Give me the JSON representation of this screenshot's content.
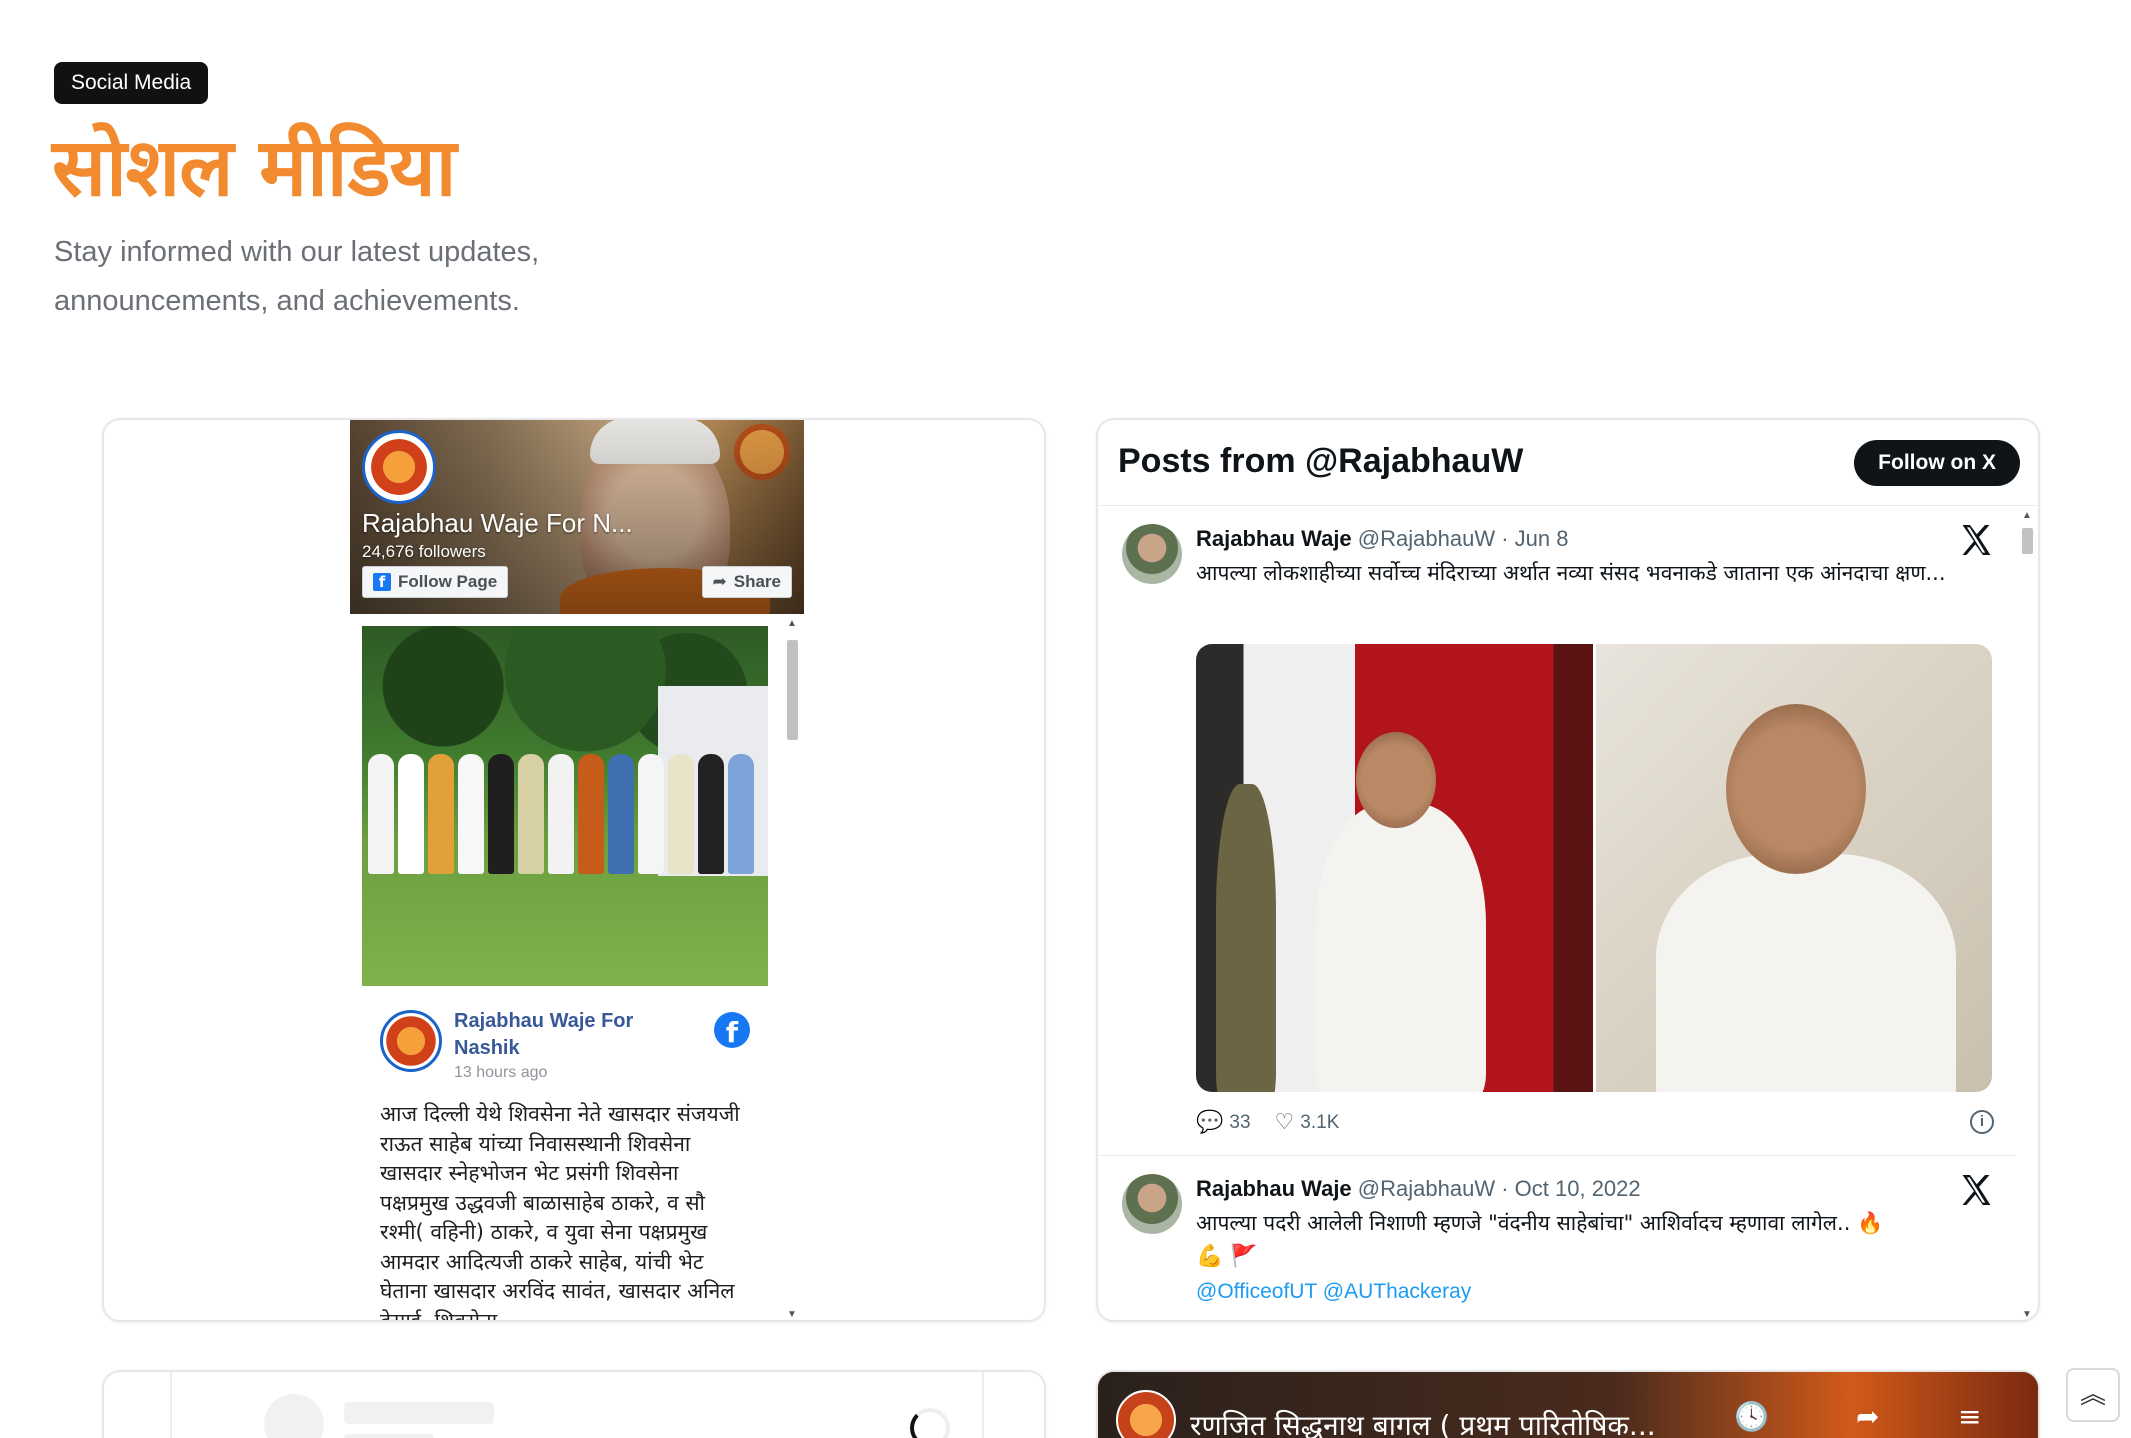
{
  "section": {
    "tag": "Social Media",
    "title": "सोशल मीडिया",
    "subtitle": "Stay informed with our latest updates, announcements, and achievements."
  },
  "facebook": {
    "page_name": "Rajabhau Waje For N...",
    "followers": "24,676 followers",
    "follow_label": "Follow Page",
    "share_label": "Share",
    "post": {
      "author": "Rajabhau Waje For Nashik",
      "time": "13 hours ago",
      "text": "आज दिल्ली येथे शिवसेना नेते खासदार संजयजी राऊत साहेब यांच्या निवासस्थानी शिवसेना खासदार स्नेहभोजन भेट प्रसंगी शिवसेना पक्षप्रमुख उद्धवजी बाळासाहेब ठाकरे, व सौ रश्मी( वहिनी) ठाकरे, व युवा सेना पक्षप्रमुख आमदार आदित्यजी ठाकरे साहेब, यांची भेट घेताना खासदार अरविंद सावंत, खासदार अनिल देसाई, शिवसेना"
    }
  },
  "x": {
    "header_title": "Posts from @RajabhauW",
    "follow_label": "Follow on X",
    "tweets": [
      {
        "name": "Rajabhau Waje",
        "handle": "@RajabhauW",
        "date": "· Jun 8",
        "text": "आपल्या लोकशाहीच्या सर्वोच्च मंदिराच्या अर्थात नव्या संसद भवनाकडे जाताना एक आंनदाचा क्षण...",
        "replies": "33",
        "likes": "3.1K"
      },
      {
        "name": "Rajabhau Waje",
        "handle": "@RajabhauW",
        "date": "· Oct 10, 2022",
        "text": "आपल्या पदरी आलेली निशाणी म्हणजे \"वंदनीय साहेबांचा\" आशिर्वादच म्हणावा लागेल.. 🔥",
        "emoji_line": "💪 🚩",
        "mentions": "@OfficeofUT @AUThackeray"
      }
    ]
  },
  "youtube": {
    "video_title": "रणजित सिद्धनाथ बागल ( प्रथम पारितोषिक..."
  },
  "icons": {
    "reply": "reply-icon",
    "like": "heart-icon",
    "info": "info-icon",
    "x_logo": "x-logo-icon",
    "facebook": "facebook-icon",
    "scroll_top": "chevron-double-up-icon"
  },
  "colors": {
    "accent": "#f28a2f",
    "facebook_blue": "#1877f2",
    "x_black": "#0f1419",
    "link_blue": "#1d9bf0"
  }
}
